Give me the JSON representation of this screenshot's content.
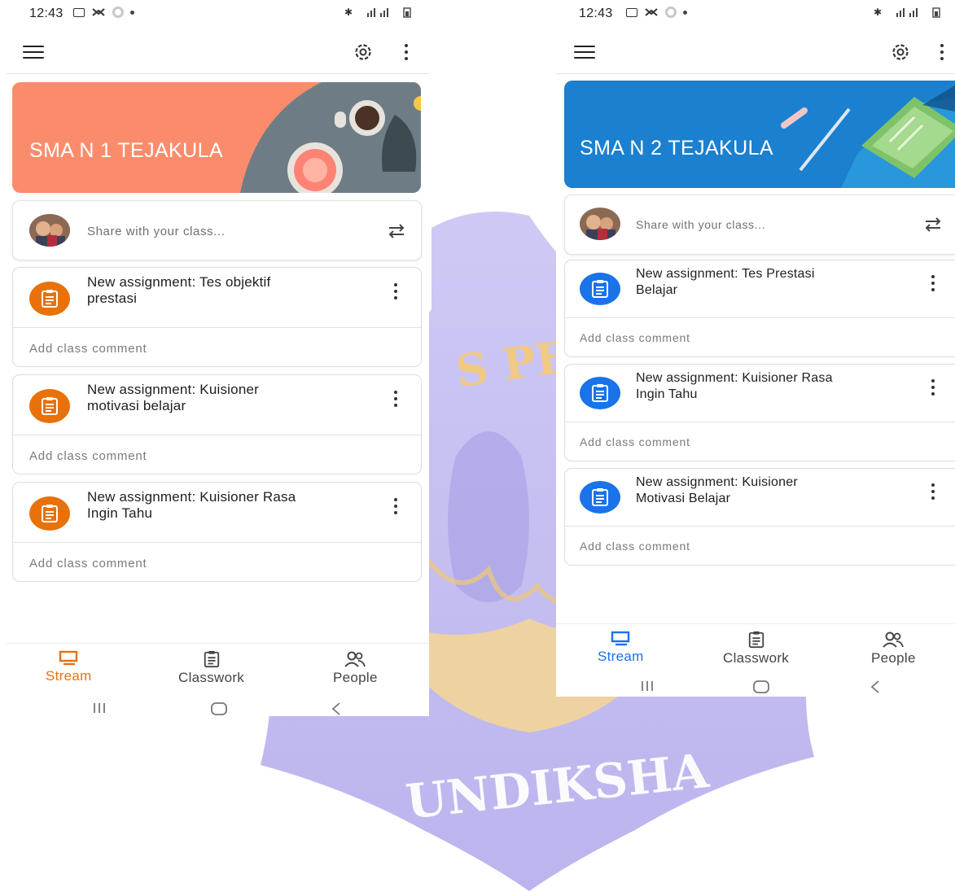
{
  "left": {
    "status_time": "12:43",
    "class_name": "SMA N 1 TEJAKULA",
    "banner_color": "#fb8c6b",
    "share_placeholder": "Share with your class...",
    "assignments": [
      {
        "title_line1": "New assignment: Tes objektif",
        "title_line2": "prestasi",
        "comment": "Add class comment"
      },
      {
        "title_line1": "New assignment: Kuisioner",
        "title_line2": "motivasi belajar",
        "comment": "Add class comment"
      },
      {
        "title_line1": "New assignment: Kuisioner Rasa",
        "title_line2": "Ingin Tahu",
        "comment": "Add class comment"
      }
    ],
    "nav": {
      "stream": "Stream",
      "classwork": "Classwork",
      "people": "People"
    },
    "accent": "#e8710a"
  },
  "right": {
    "status_time": "12:43",
    "class_name": "SMA N 2 TEJAKULA",
    "banner_color": "#1a80cf",
    "share_placeholder": "Share with your class...",
    "assignments": [
      {
        "title_line1": "New assignment: Tes Prestasi",
        "title_line2": "Belajar",
        "comment": "Add class comment"
      },
      {
        "title_line1": "New assignment: Kuisioner Rasa",
        "title_line2": "Ingin Tahu",
        "comment": "Add class comment"
      },
      {
        "title_line1": "New assignment: Kuisioner",
        "title_line2": "Motivasi Belajar",
        "comment": "Add class comment"
      }
    ],
    "nav": {
      "stream": "Stream",
      "classwork": "Classwork",
      "people": "People"
    },
    "accent": "#1a73e8"
  },
  "watermark": {
    "arc_text": "S PENDI",
    "bottom_text": "UNDIKSHA",
    "color": "#b9b2ee"
  }
}
